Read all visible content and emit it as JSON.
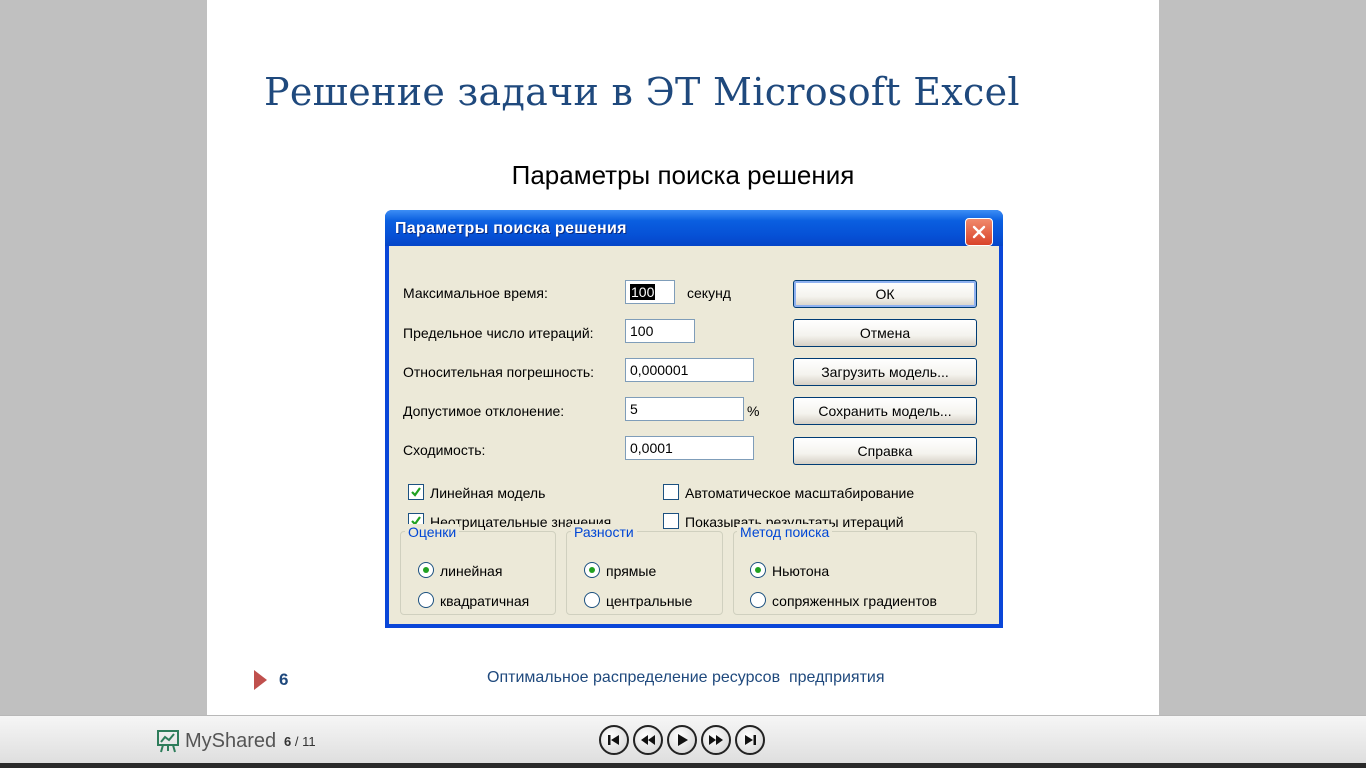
{
  "slide": {
    "title": "Решение задачи в ЭТ Microsoft Excel",
    "subtitle": "Параметры поиска решения",
    "page_number": "6",
    "footer_text": "Оптимальное распределение ресурсов  предприятия"
  },
  "dialog": {
    "title": "Параметры поиска решения",
    "fields": {
      "max_time_label": "Максимальное время:",
      "max_time_value": "100",
      "max_time_unit": "секунд",
      "iterations_label": "Предельное число итераций:",
      "iterations_value": "100",
      "precision_label": "Относительная погрешность:",
      "precision_value": "0,000001",
      "tolerance_label": "Допустимое отклонение:",
      "tolerance_value": "5",
      "tolerance_unit": "%",
      "convergence_label": "Сходимость:",
      "convergence_value": "0,0001"
    },
    "buttons": {
      "ok": "ОК",
      "cancel": "Отмена",
      "load": "Загрузить модель...",
      "save": "Сохранить модель...",
      "help": "Справка"
    },
    "checkboxes": {
      "linear_model": "Линейная модель",
      "linear_model_checked": true,
      "non_negative": "Неотрицательные значения",
      "non_negative_checked": true,
      "auto_scaling": "Автоматическое масштабирование",
      "auto_scaling_checked": false,
      "show_iterations": "Показывать результаты итераций",
      "show_iterations_checked": false
    },
    "groups": {
      "estimates": {
        "title": "Оценки",
        "options": [
          "линейная",
          "квадратичная"
        ],
        "selected": "линейная"
      },
      "derivatives": {
        "title": "Разности",
        "options": [
          "прямые",
          "центральные"
        ],
        "selected": "прямые"
      },
      "search": {
        "title": "Метод поиска",
        "options": [
          "Ньютона",
          "сопряженных градиентов"
        ],
        "selected": "Ньютона"
      }
    }
  },
  "viewer": {
    "logo": "MyShared",
    "current_page": "6",
    "total_pages": "11"
  },
  "colors": {
    "title_blue": "#1f497d",
    "accent_red": "#c0504d",
    "xp_titlebar": "#0a5fe0",
    "dialog_face": "#ece9d8",
    "group_legend": "#0046d5"
  }
}
